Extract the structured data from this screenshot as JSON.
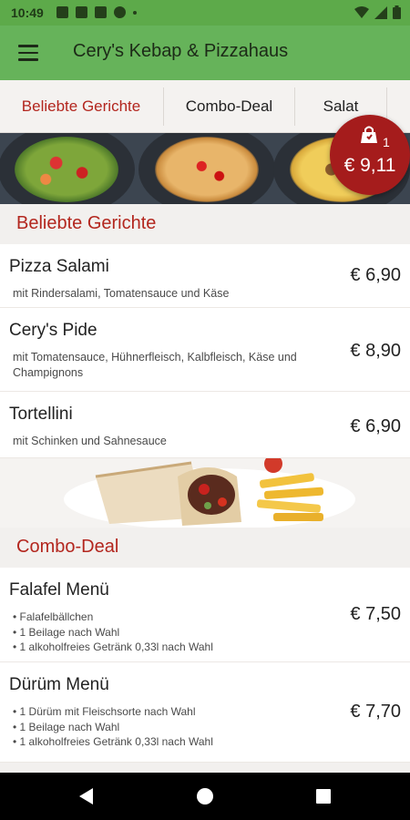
{
  "status": {
    "time": "10:49"
  },
  "app": {
    "title": "Cery's Kebap & Pizzahaus"
  },
  "tabs": [
    {
      "label": "Beliebte Gerichte",
      "active": true
    },
    {
      "label": "Combo-Deal",
      "active": false
    },
    {
      "label": "Salat",
      "active": false
    }
  ],
  "cart": {
    "count": "1",
    "total": "€ 9,11"
  },
  "sections": [
    {
      "title": "Beliebte Gerichte",
      "items": [
        {
          "name": "Pizza Salami",
          "desc": "mit Rindersalami, Tomatensauce und Käse",
          "price": "€ 6,90"
        },
        {
          "name": "Cery's Pide",
          "desc": "mit Tomatensauce, Hühnerfleisch, Kalbfleisch, Käse und Champignons",
          "price": "€ 8,90"
        },
        {
          "name": "Tortellini",
          "desc": "mit Schinken und Sahnesauce",
          "price": "€ 6,90"
        }
      ]
    },
    {
      "title": "Combo-Deal",
      "items": [
        {
          "name": "Falafel Menü",
          "lines": [
            "• Falafelbällchen",
            "• 1 Beilage nach Wahl",
            "• 1 alkoholfreies Getränk 0,33l nach Wahl"
          ],
          "price": "€ 7,50"
        },
        {
          "name": "Dürüm Menü",
          "lines": [
            "• 1 Dürüm mit Fleischsorte nach Wahl",
            "• 1 Beilage nach Wahl",
            "• 1 alkoholfreies Getränk 0,33l nach Wahl"
          ],
          "price": "€ 7,70"
        }
      ]
    }
  ],
  "colors": {
    "appbar": "#66b35a",
    "accent": "#b3261e",
    "badge": "#a51c1c"
  }
}
